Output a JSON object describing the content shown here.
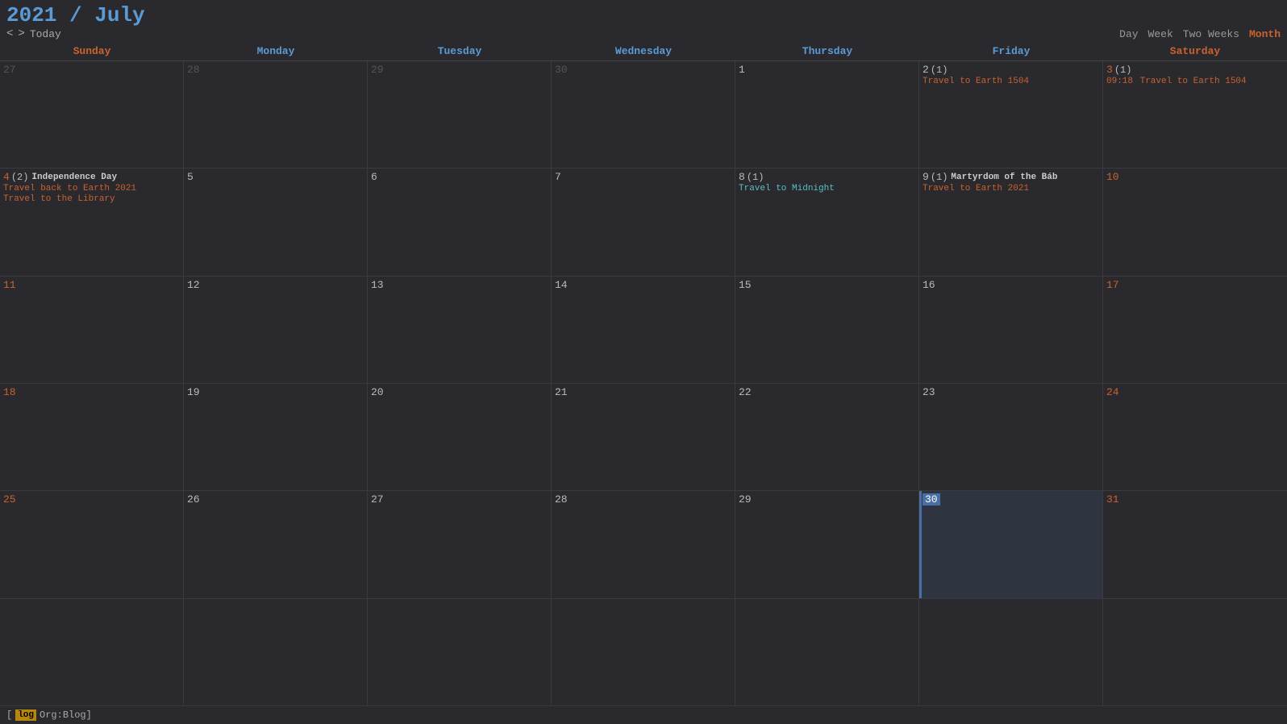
{
  "header": {
    "year": "2021",
    "slash": " / ",
    "month": "July",
    "nav": {
      "prev": "<",
      "next": ">",
      "today": "Today"
    },
    "views": [
      "Day",
      "Week",
      "Two Weeks",
      "Month"
    ],
    "active_view": "Month"
  },
  "day_headers": [
    {
      "label": "Sunday",
      "type": "weekend"
    },
    {
      "label": "Monday",
      "type": "weekday"
    },
    {
      "label": "Tuesday",
      "type": "weekday"
    },
    {
      "label": "Wednesday",
      "type": "weekday"
    },
    {
      "label": "Thursday",
      "type": "weekday"
    },
    {
      "label": "Friday",
      "type": "weekday"
    },
    {
      "label": "Saturday",
      "type": "weekend"
    }
  ],
  "weeks": [
    [
      {
        "day": "27",
        "other_month": true,
        "events": []
      },
      {
        "day": "28",
        "other_month": true,
        "events": []
      },
      {
        "day": "29",
        "other_month": true,
        "events": []
      },
      {
        "day": "30",
        "other_month": true,
        "events": []
      },
      {
        "day": "1",
        "events": []
      },
      {
        "day": "2",
        "count": 1,
        "events": [
          {
            "text": "Travel to Earth 1504",
            "style": "orange"
          }
        ]
      },
      {
        "day": "3",
        "saturday": true,
        "count": 1,
        "events": [
          {
            "time": "09:18",
            "text": "Travel to Earth 1504",
            "style": "orange"
          }
        ]
      }
    ],
    [
      {
        "day": "4",
        "sunday": true,
        "count": 2,
        "events": [
          {
            "text": "Independence Day",
            "style": "bold"
          },
          {
            "text": "Travel back to Earth 2021",
            "style": "orange"
          },
          {
            "text": "Travel to the Library",
            "style": "orange"
          }
        ]
      },
      {
        "day": "5",
        "events": []
      },
      {
        "day": "6",
        "events": []
      },
      {
        "day": "7",
        "events": []
      },
      {
        "day": "8",
        "count": 1,
        "events": [
          {
            "text": "Travel to Midnight",
            "style": "cyan"
          }
        ]
      },
      {
        "day": "9",
        "count": 1,
        "events": [
          {
            "text": "Martyrdom of the Báb",
            "style": "bold"
          },
          {
            "text": "Travel to Earth 2021",
            "style": "orange"
          }
        ]
      },
      {
        "day": "10",
        "saturday": true,
        "events": []
      }
    ],
    [
      {
        "day": "11",
        "sunday": true,
        "events": []
      },
      {
        "day": "12",
        "events": []
      },
      {
        "day": "13",
        "events": []
      },
      {
        "day": "14",
        "events": []
      },
      {
        "day": "15",
        "events": []
      },
      {
        "day": "16",
        "events": []
      },
      {
        "day": "17",
        "saturday": true,
        "events": []
      }
    ],
    [
      {
        "day": "18",
        "sunday": true,
        "events": []
      },
      {
        "day": "19",
        "events": []
      },
      {
        "day": "20",
        "events": []
      },
      {
        "day": "21",
        "events": []
      },
      {
        "day": "22",
        "events": []
      },
      {
        "day": "23",
        "events": []
      },
      {
        "day": "24",
        "saturday": true,
        "events": []
      }
    ],
    [
      {
        "day": "25",
        "sunday": true,
        "events": []
      },
      {
        "day": "26",
        "events": []
      },
      {
        "day": "27",
        "events": []
      },
      {
        "day": "28",
        "events": []
      },
      {
        "day": "29",
        "events": []
      },
      {
        "day": "30",
        "today": true,
        "events": []
      },
      {
        "day": "31",
        "saturday": true,
        "events": []
      }
    ],
    [
      {
        "day": "",
        "events": []
      },
      {
        "day": "",
        "events": []
      },
      {
        "day": "",
        "events": []
      },
      {
        "day": "",
        "events": []
      },
      {
        "day": "",
        "events": []
      },
      {
        "day": "",
        "events": []
      },
      {
        "day": "",
        "events": []
      }
    ]
  ],
  "footer": {
    "tag": "log",
    "label": "Org:Blog]"
  }
}
